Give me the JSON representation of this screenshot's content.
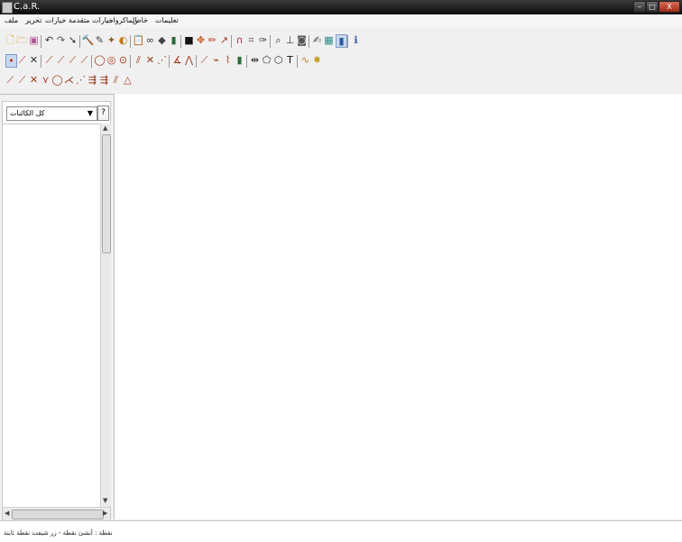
{
  "window": {
    "title": "C.a.R.",
    "minimize_label": "–",
    "maximize_label": "□",
    "close_label": "X"
  },
  "menu": [
    "تعليمات",
    "خاص",
    "الماكروات",
    "خيارات متقدمة",
    "خيارات",
    "تحرير",
    "ملف"
  ],
  "toolbar": {
    "row1": [
      {
        "name": "new-file-icon",
        "glyph": "🗋",
        "color": "#e0a52a"
      },
      {
        "name": "open-file-icon",
        "glyph": "🗁",
        "color": "#d9a73a"
      },
      {
        "name": "save-file-icon",
        "glyph": "▣",
        "color": "#b25a9a"
      },
      {
        "sep": true
      },
      {
        "name": "undo-icon",
        "glyph": "↶",
        "color": "#333"
      },
      {
        "name": "undo-all-icon",
        "glyph": "↷",
        "color": "#555"
      },
      {
        "name": "back-icon",
        "glyph": "➘",
        "color": "#333"
      },
      {
        "sep": true
      },
      {
        "name": "hammer-icon",
        "glyph": "🔨",
        "color": "#8a5a2a"
      },
      {
        "name": "move-icon",
        "glyph": "✎",
        "color": "#444"
      },
      {
        "name": "pin-icon",
        "glyph": "✦",
        "color": "#8a5a2a"
      },
      {
        "name": "hide-icon",
        "glyph": "◐",
        "color": "#c67a1a"
      },
      {
        "sep": true
      },
      {
        "name": "clipboard-icon",
        "glyph": "📋",
        "color": "#8a6a2a"
      },
      {
        "name": "infinity-icon",
        "glyph": "∞",
        "color": "#333"
      },
      {
        "name": "diamond-icon",
        "glyph": "◆",
        "color": "#444"
      },
      {
        "name": "book-icon",
        "glyph": "▮",
        "color": "#2a6a3a"
      },
      {
        "sep": true
      },
      {
        "name": "black-square-icon",
        "glyph": "■",
        "color": "#111"
      },
      {
        "name": "arrows-icon",
        "glyph": "✥",
        "color": "#c05a2a"
      },
      {
        "name": "pencil-icon",
        "glyph": "✏",
        "color": "#c03a1a"
      },
      {
        "name": "ray-icon",
        "glyph": "↗",
        "color": "#a03a1a"
      },
      {
        "sep": true
      },
      {
        "name": "magnet-icon",
        "glyph": "∩",
        "color": "#a02a2a"
      },
      {
        "name": "grid-icon",
        "glyph": "⌗",
        "color": "#555"
      },
      {
        "name": "text-edit-icon",
        "glyph": "✑",
        "color": "#333"
      },
      {
        "sep": true
      },
      {
        "name": "zoom-icon",
        "glyph": "⌕",
        "color": "#333"
      },
      {
        "name": "perpendicular-icon",
        "glyph": "⊥",
        "color": "#333"
      },
      {
        "name": "camera-icon",
        "glyph": "◙",
        "color": "#555"
      },
      {
        "sep": true
      },
      {
        "name": "draw-icon",
        "glyph": "✍",
        "color": "#444"
      },
      {
        "name": "palette-icon",
        "glyph": "▦",
        "color": "#2a8a8a"
      },
      {
        "name": "select-mode-icon",
        "glyph": "▮",
        "color": "#2a5aa0",
        "sel": true
      },
      {
        "sep": true
      },
      {
        "name": "info-icon",
        "glyph": "ℹ",
        "color": "#2a5aa0"
      }
    ],
    "row2": [
      {
        "name": "point-icon",
        "glyph": "•",
        "color": "#c03a1a",
        "sel": true
      },
      {
        "name": "segment-icon",
        "glyph": "⟋",
        "color": "#c03a1a"
      },
      {
        "name": "intersection-icon",
        "glyph": "✕",
        "color": "#333"
      },
      {
        "sep": true
      },
      {
        "name": "line-icon",
        "glyph": "⟋",
        "color": "#a03a1a"
      },
      {
        "name": "ray-tool-icon",
        "glyph": "⟋",
        "color": "#a03a1a"
      },
      {
        "name": "vector-icon",
        "glyph": "⟋",
        "color": "#a03a1a"
      },
      {
        "name": "fixed-segment-icon",
        "glyph": "⟋",
        "color": "#a03a1a"
      },
      {
        "sep": true
      },
      {
        "name": "circle-icon",
        "glyph": "◯",
        "color": "#a03a1a"
      },
      {
        "name": "circle-3pt-icon",
        "glyph": "◎",
        "color": "#a03a1a"
      },
      {
        "name": "fixed-circle-icon",
        "glyph": "⊙",
        "color": "#a03a1a"
      },
      {
        "sep": true
      },
      {
        "name": "parallel-icon",
        "glyph": "⫽",
        "color": "#a03a1a"
      },
      {
        "name": "perpendicular-tool-icon",
        "glyph": "✕",
        "color": "#a03a1a"
      },
      {
        "name": "midpoint-icon",
        "glyph": "⋰",
        "color": "#a03a1a"
      },
      {
        "sep": true
      },
      {
        "name": "angle-icon",
        "glyph": "∡",
        "color": "#a03a1a"
      },
      {
        "name": "fixed-angle-icon",
        "glyph": "⋀",
        "color": "#a03a1a"
      },
      {
        "sep": true
      },
      {
        "name": "move-point-icon",
        "glyph": "⟋",
        "color": "#a03a1a"
      },
      {
        "name": "reflect-icon",
        "glyph": "⌁",
        "color": "#a03a1a"
      },
      {
        "name": "trace-icon",
        "glyph": "⌇",
        "color": "#a03a1a"
      },
      {
        "name": "book-tool-icon",
        "glyph": "▮",
        "color": "#2a6a3a"
      },
      {
        "sep": true
      },
      {
        "name": "distance-icon",
        "glyph": "⇹",
        "color": "#333"
      },
      {
        "name": "polygon-icon",
        "glyph": "⬠",
        "color": "#333"
      },
      {
        "name": "conic-icon",
        "glyph": "⬡",
        "color": "#333"
      },
      {
        "name": "text-icon",
        "glyph": "T",
        "color": "#111"
      },
      {
        "sep": true
      },
      {
        "name": "function-icon",
        "glyph": "∿",
        "color": "#c67a1a"
      },
      {
        "name": "locus-icon",
        "glyph": "✸",
        "color": "#c6a12a"
      }
    ],
    "row3": [
      {
        "name": "bisector-icon",
        "glyph": "⟋",
        "color": "#a03a1a"
      },
      {
        "name": "tangent-icon",
        "glyph": "⟋",
        "color": "#a03a1a"
      },
      {
        "name": "cross-icon",
        "glyph": "✕",
        "color": "#a03a1a"
      },
      {
        "name": "angle-bisector-icon",
        "glyph": "⋎",
        "color": "#a03a1a"
      },
      {
        "name": "circle-point-icon",
        "glyph": "◯",
        "color": "#a03a1a"
      },
      {
        "name": "reflection-icon",
        "glyph": "⋌",
        "color": "#a03a1a"
      },
      {
        "name": "dots-icon",
        "glyph": "⋰",
        "color": "#a03a1a"
      },
      {
        "name": "arrows-tool-icon",
        "glyph": "⇶",
        "color": "#a03a1a"
      },
      {
        "name": "multi-arrow-icon",
        "glyph": "⇶",
        "color": "#a03a1a"
      },
      {
        "name": "parallel-lines-icon",
        "glyph": "⫽",
        "color": "#a03a1a"
      },
      {
        "name": "triangle-icon",
        "glyph": "△",
        "color": "#a03a1a"
      }
    ]
  },
  "left_panel": {
    "object_select": "كل الكائنات",
    "help_label": "?"
  },
  "status": "نقطة : أنشئ نقطة - زر شيفت نقطة ثابتة"
}
